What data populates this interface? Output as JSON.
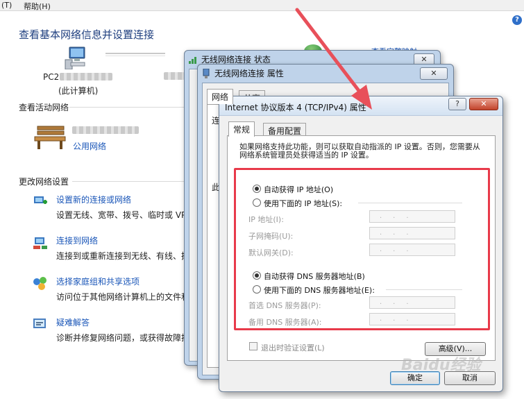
{
  "menu": {
    "view_partial": "(T)",
    "help": "帮助(H)"
  },
  "control_panel": {
    "title": "查看基本网络信息并设置连接",
    "see_full_map": "查看完整映射",
    "computer_name": "PC2",
    "computer_sub": "(此计算机)",
    "active_networks_label": "查看活动网络",
    "network_type_link": "公用网络",
    "change_settings_label": "更改网络设置",
    "tasks": [
      {
        "link": "设置新的连接或网络",
        "desc": "设置无线、宽带、拨号、临时或 VPN 连接；或设置路由器或访问点。",
        "icon": "new-connection-icon"
      },
      {
        "link": "连接到网络",
        "desc": "连接到或重新连接到无线、有线、拨号或 VPN 网络连接。",
        "icon": "connect-network-icon"
      },
      {
        "link": "选择家庭组和共享选项",
        "desc": "访问位于其他网络计算机上的文件和打印机，或更改共享设置。",
        "icon": "homegroup-icon"
      },
      {
        "link": "疑难解答",
        "desc": "诊断并修复网络问题，或获得故障排除信息。",
        "icon": "troubleshoot-icon"
      }
    ]
  },
  "status_dialog": {
    "title": "无线网络连接 状态"
  },
  "props_dialog": {
    "title": "无线网络连接 属性",
    "tabs": [
      "网络",
      "共享"
    ],
    "partial_label_1": "连",
    "partial_label_2": "此"
  },
  "ipv4_dialog": {
    "title": "Internet 协议版本 4 (TCP/IPv4) 属性",
    "help_btn": "?",
    "close_btn": "✕",
    "tabs": [
      "常规",
      "备用配置"
    ],
    "intro": "如果网络支持此功能，则可以获取自动指派的 IP 设置。否则，您需要从网络系统管理员处获得适当的 IP 设置。",
    "auto_ip": "自动获得 IP 地址(O)",
    "manual_ip": "使用下面的 IP 地址(S):",
    "ip_address": "IP 地址(I):",
    "subnet_mask": "子网掩码(U):",
    "default_gateway": "默认网关(D):",
    "auto_dns": "自动获得 DNS 服务器地址(B)",
    "manual_dns": "使用下面的 DNS 服务器地址(E):",
    "preferred_dns": "首选 DNS 服务器(P):",
    "alternate_dns": "备用 DNS 服务器(A):",
    "ip_placeholder": "...",
    "validate_on_exit": "退出时验证设置(L)",
    "advanced_btn": "高级(V)...",
    "ok_btn": "确定",
    "cancel_btn": "取消"
  },
  "watermark": "Baidu经验",
  "colors": {
    "highlight": "#e83a4a",
    "arrow": "#e8505a",
    "link": "#1a56b8"
  }
}
